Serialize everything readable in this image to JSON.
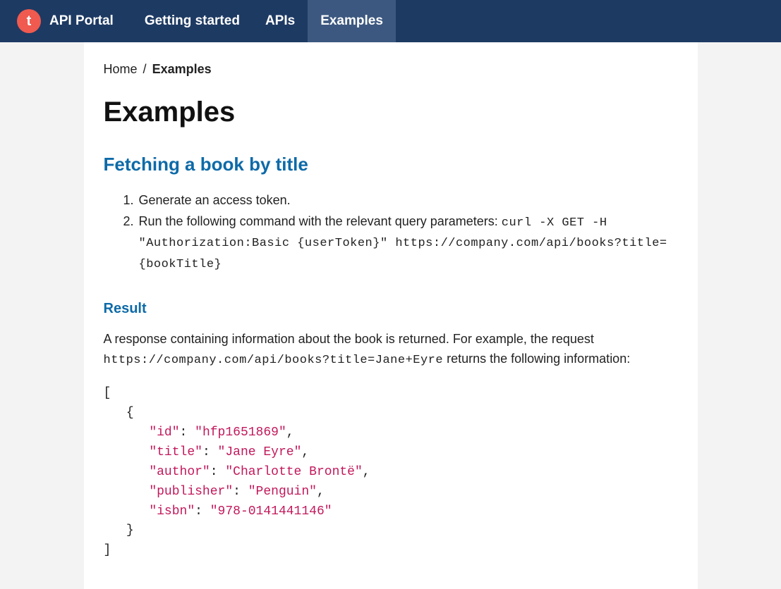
{
  "nav": {
    "logo_letter": "t",
    "brand": "API Portal",
    "items": [
      {
        "label": "Getting started",
        "active": false
      },
      {
        "label": "APIs",
        "active": false
      },
      {
        "label": "Examples",
        "active": true
      }
    ]
  },
  "breadcrumb": {
    "home": "Home",
    "sep": "/",
    "current": "Examples"
  },
  "page_title": "Examples",
  "section1": {
    "title": "Fetching a book by title",
    "step1": "Generate an access token.",
    "step2_text": "Run the following command with the relevant query parameters: ",
    "step2_code": "curl -X GET -H \"Authorization:Basic {userToken}\" https://company.com/api/books?title={bookTitle}"
  },
  "result": {
    "title": "Result",
    "para_a": "A response containing information about the book is returned. For example, the request ",
    "para_code": "https://company.com/api/books?title=Jane+Eyre",
    "para_b": " returns the following information:",
    "json": {
      "id_key": "\"id\"",
      "id_val": "\"hfp1651869\"",
      "title_key": "\"title\"",
      "title_val": "\"Jane Eyre\"",
      "author_key": "\"author\"",
      "author_val": "\"Charlotte Brontë\"",
      "publisher_key": "\"publisher\"",
      "publisher_val": "\"Penguin\"",
      "isbn_key": "\"isbn\"",
      "isbn_val": "\"978-0141441146\""
    }
  }
}
